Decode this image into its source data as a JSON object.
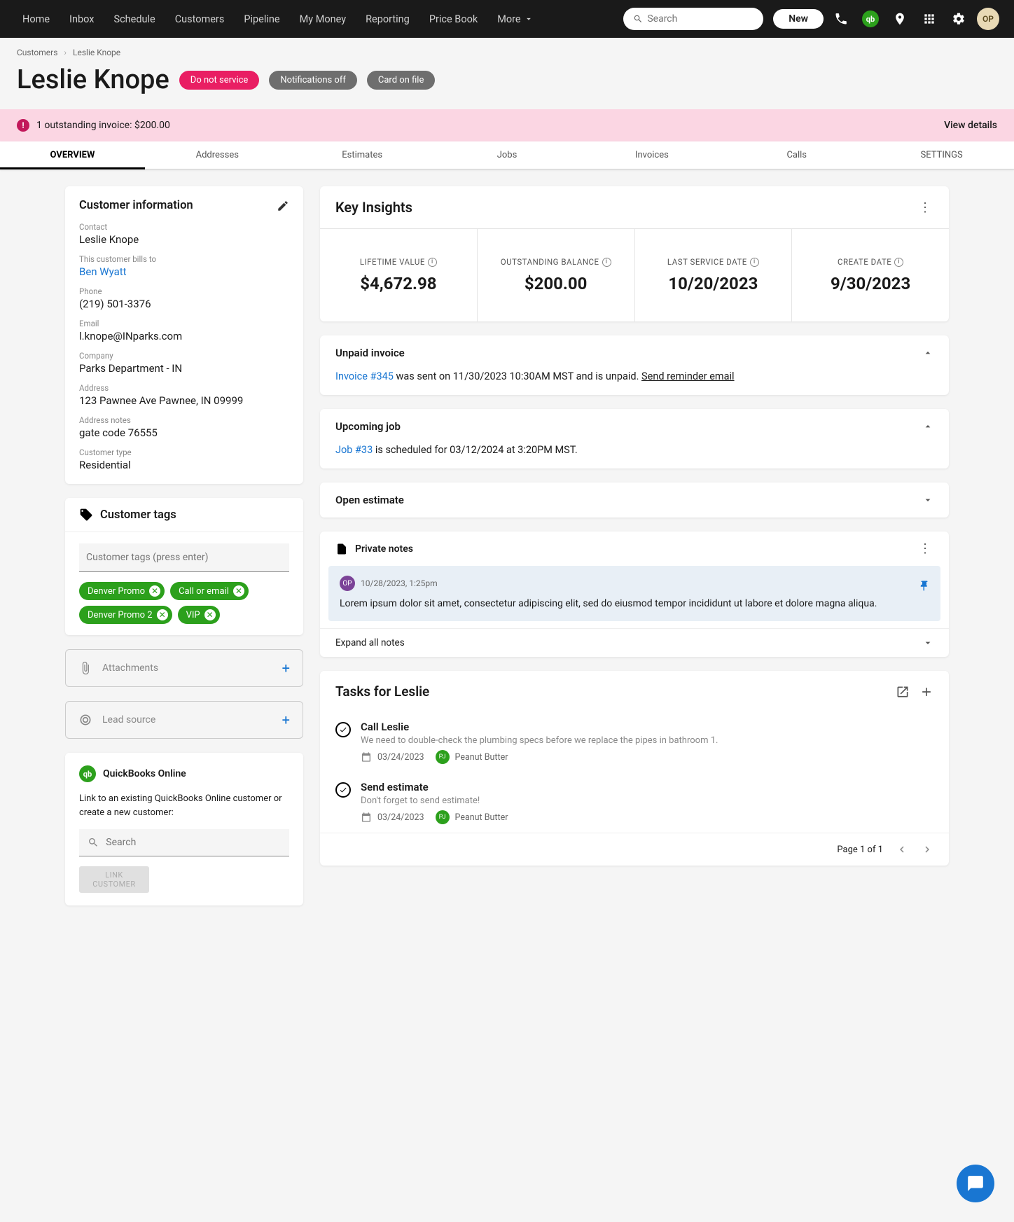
{
  "topnav": {
    "items": [
      "Home",
      "Inbox",
      "Schedule",
      "Customers",
      "Pipeline",
      "My Money",
      "Reporting",
      "Price Book",
      "More"
    ],
    "search_placeholder": "Search",
    "new_label": "New",
    "avatar": "OP"
  },
  "breadcrumb": {
    "root": "Customers",
    "current": "Leslie Knope"
  },
  "page": {
    "title": "Leslie Knope",
    "pills": [
      "Do not service",
      "Notifications off",
      "Card on file"
    ]
  },
  "banner": {
    "text": "1 outstanding invoice: $200.00",
    "action": "View details"
  },
  "tabs": [
    "OVERVIEW",
    "Addresses",
    "Estimates",
    "Jobs",
    "Invoices",
    "Calls",
    "SETTINGS"
  ],
  "customer_info": {
    "title": "Customer information",
    "contact_label": "Contact",
    "contact": "Leslie Knope",
    "bills_label": "This customer bills to",
    "bills_to": "Ben Wyatt",
    "phone_label": "Phone",
    "phone": "(219) 501-3376",
    "email_label": "Email",
    "email": "l.knope@INparks.com",
    "company_label": "Company",
    "company": "Parks Department - IN",
    "address_label": "Address",
    "address": "123 Pawnee Ave Pawnee, IN 09999",
    "notes_label": "Address notes",
    "notes": "gate code 76555",
    "type_label": "Customer type",
    "type": "Residential"
  },
  "tags_card": {
    "title": "Customer tags",
    "placeholder": "Customer tags (press enter)",
    "tags": [
      "Denver Promo",
      "Call or email",
      "Denver Promo 2",
      "VIP"
    ]
  },
  "attachments": {
    "label": "Attachments"
  },
  "leadsource": {
    "label": "Lead source"
  },
  "qbo": {
    "title": "QuickBooks Online",
    "text": "Link to an existing QuickBooks Online customer or create a new customer:",
    "search_placeholder": "Search",
    "button": "LINK CUSTOMER"
  },
  "insights": {
    "title": "Key Insights",
    "cells": [
      {
        "label": "LIFETIME VALUE",
        "value": "$4,672.98",
        "info": true
      },
      {
        "label": "OUTSTANDING BALANCE",
        "value": "$200.00",
        "info": true
      },
      {
        "label": "LAST SERVICE DATE",
        "value": "10/20/2023",
        "info": true
      },
      {
        "label": "CREATE DATE",
        "value": "9/30/2023",
        "info": true
      }
    ]
  },
  "unpaid": {
    "title": "Unpaid invoice",
    "link": "Invoice #345",
    "text": " was sent on 11/30/2023 10:30AM MST and is unpaid. ",
    "action": "Send reminder email"
  },
  "upcoming": {
    "title": "Upcoming job",
    "link": "Job #33",
    "text": " is scheduled for 03/12/2024 at 3:20PM MST."
  },
  "open_estimate": {
    "title": "Open estimate"
  },
  "private_notes": {
    "title": "Private notes",
    "author": "OP",
    "meta": "10/28/2023, 1:25pm",
    "body": "Lorem ipsum dolor sit amet, consectetur adipiscing elit, sed do eiusmod tempor incididunt ut labore et dolore magna aliqua.",
    "expand": "Expand all notes"
  },
  "tasks": {
    "title": "Tasks for Leslie",
    "items": [
      {
        "title": "Call Leslie",
        "desc": "We need to double-check the plumbing specs before we replace the pipes in bathroom 1.",
        "date": "03/24/2023",
        "assignee": "Peanut Butter",
        "initials": "PJ"
      },
      {
        "title": "Send estimate",
        "desc": "Don't forget to send estimate!",
        "date": "03/24/2023",
        "assignee": "Peanut Butter",
        "initials": "PJ"
      }
    ],
    "pager": "Page 1 of 1"
  }
}
